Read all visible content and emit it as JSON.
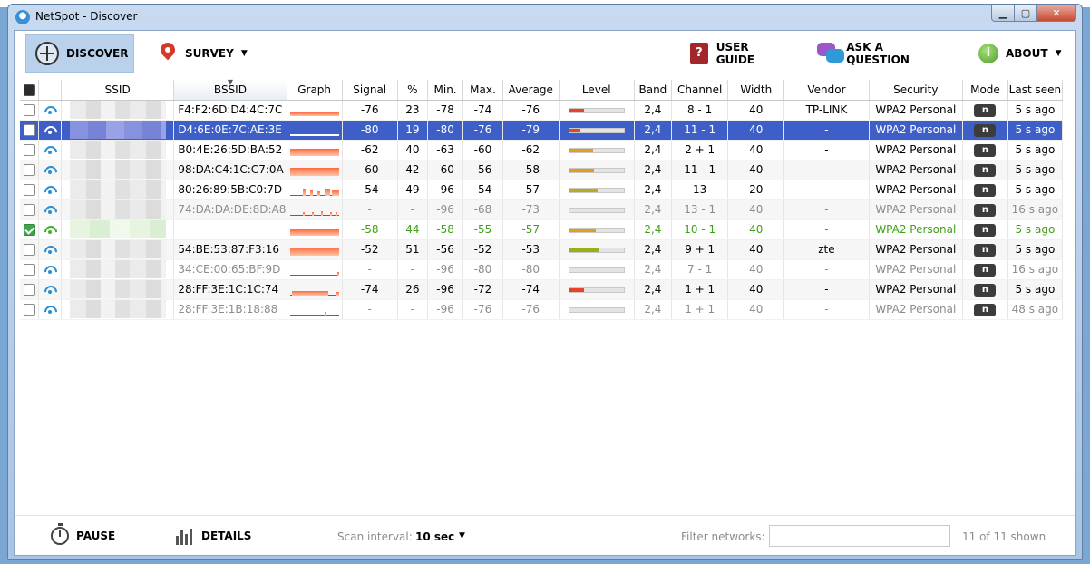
{
  "window": {
    "title": "NetSpot - Discover"
  },
  "toolbar": {
    "discover": "DISCOVER",
    "survey": "SURVEY",
    "user_guide": "USER GUIDE",
    "ask": "ASK A QUESTION",
    "about": "ABOUT",
    "guide_icon_glyph": "?",
    "about_icon_glyph": "i"
  },
  "columns": [
    "SSID",
    "BSSID",
    "Graph",
    "Signal",
    "%",
    "Min.",
    "Max.",
    "Average",
    "Level",
    "Band",
    "Channel",
    "Width",
    "Vendor",
    "Security",
    "Mode",
    "Last seen"
  ],
  "rows": [
    {
      "bssid": "F4:F2:6D:D4:4C:7C",
      "signal": "-76",
      "pct": "23",
      "min": "-78",
      "max": "-74",
      "avg": "-76",
      "level": 0.26,
      "level_color": "#e8432a",
      "band": "2,4",
      "channel": "8 - 1",
      "width": "40",
      "vendor": "TP-LINK",
      "security": "WPA2 Personal",
      "mode": "n",
      "last_seen": "5 s ago",
      "state": "",
      "checked": false,
      "graph": [
        [
          0,
          54,
          4
        ]
      ]
    },
    {
      "bssid": "D4:6E:0E:7C:AE:3E",
      "signal": "-80",
      "pct": "19",
      "min": "-80",
      "max": "-76",
      "avg": "-79",
      "level": 0.2,
      "level_color": "#e8432a",
      "band": "2,4",
      "channel": "11 - 1",
      "width": "40",
      "vendor": "-",
      "security": "WPA2 Personal",
      "mode": "n",
      "last_seen": "5 s ago",
      "state": "sel",
      "checked": false,
      "graph": [
        [
          0,
          54,
          2
        ]
      ]
    },
    {
      "bssid": "B0:4E:26:5D:BA:52",
      "signal": "-62",
      "pct": "40",
      "min": "-63",
      "max": "-60",
      "avg": "-62",
      "level": 0.42,
      "level_color": "#e89a1a",
      "band": "2,4",
      "channel": "2 + 1",
      "width": "40",
      "vendor": "-",
      "security": "WPA2 Personal",
      "mode": "n",
      "last_seen": "5 s ago",
      "state": "",
      "checked": false,
      "graph": [
        [
          0,
          54,
          8
        ]
      ]
    },
    {
      "bssid": "98:DA:C4:1C:C7:0A",
      "signal": "-60",
      "pct": "42",
      "min": "-60",
      "max": "-56",
      "avg": "-58",
      "level": 0.44,
      "level_color": "#e89a1a",
      "band": "2,4",
      "channel": "11 - 1",
      "width": "40",
      "vendor": "-",
      "security": "WPA2 Personal",
      "mode": "n",
      "last_seen": "5 s ago",
      "state": "",
      "checked": false,
      "graph": [
        [
          0,
          54,
          9
        ]
      ]
    },
    {
      "bssid": "80:26:89:5B:C0:7D",
      "signal": "-54",
      "pct": "49",
      "min": "-96",
      "max": "-54",
      "avg": "-57",
      "level": 0.5,
      "level_color": "#b6ad1c",
      "band": "2,4",
      "channel": "13",
      "width": "20",
      "vendor": "-",
      "security": "WPA2 Personal",
      "mode": "n",
      "last_seen": "5 s ago",
      "state": "",
      "checked": false,
      "graph": [
        [
          14,
          3,
          8
        ],
        [
          22,
          3,
          6
        ],
        [
          30,
          3,
          5
        ],
        [
          38,
          6,
          8
        ],
        [
          46,
          8,
          6
        ]
      ]
    },
    {
      "bssid": "74:DA:DA:DE:8D:A8",
      "signal": "-",
      "pct": "-",
      "min": "-96",
      "max": "-68",
      "avg": "-73",
      "level": 0,
      "level_color": "#e89a1a",
      "band": "2,4",
      "channel": "13 - 1",
      "width": "40",
      "vendor": "-",
      "security": "WPA2 Personal",
      "mode": "n",
      "last_seen": "16 s ago",
      "state": "dim",
      "checked": false,
      "graph": [
        [
          14,
          2,
          4
        ],
        [
          24,
          2,
          4
        ],
        [
          34,
          2,
          5
        ],
        [
          44,
          2,
          4
        ],
        [
          50,
          2,
          4
        ]
      ]
    },
    {
      "bssid": "",
      "signal": "-58",
      "pct": "44",
      "min": "-58",
      "max": "-55",
      "avg": "-57",
      "level": 0.46,
      "level_color": "#e89a1a",
      "band": "2,4",
      "channel": "10 - 1",
      "width": "40",
      "vendor": "-",
      "security": "WPA2 Personal",
      "mode": "n",
      "last_seen": "5 s ago",
      "state": "green",
      "checked": true,
      "graph": [
        [
          0,
          54,
          7
        ]
      ]
    },
    {
      "bssid": "54:BE:53:87:F3:16",
      "signal": "-52",
      "pct": "51",
      "min": "-56",
      "max": "-52",
      "avg": "-53",
      "level": 0.54,
      "level_color": "#9cad1c",
      "band": "2,4",
      "channel": "9 + 1",
      "width": "40",
      "vendor": "zte",
      "security": "WPA2 Personal",
      "mode": "n",
      "last_seen": "5 s ago",
      "state": "",
      "checked": false,
      "graph": [
        [
          0,
          54,
          9
        ]
      ]
    },
    {
      "bssid": "34:CE:00:65:BF:9D",
      "signal": "-",
      "pct": "-",
      "min": "-96",
      "max": "-80",
      "avg": "-80",
      "level": 0,
      "level_color": "#e8432a",
      "band": "2,4",
      "channel": "7 - 1",
      "width": "40",
      "vendor": "-",
      "security": "WPA2 Personal",
      "mode": "n",
      "last_seen": "16 s ago",
      "state": "dim",
      "checked": false,
      "graph": [
        [
          52,
          2,
          4
        ]
      ]
    },
    {
      "bssid": "28:FF:3E:1C:1C:74",
      "signal": "-74",
      "pct": "26",
      "min": "-96",
      "max": "-72",
      "avg": "-74",
      "level": 0.26,
      "level_color": "#e8432a",
      "band": "2,4",
      "channel": "1 + 1",
      "width": "40",
      "vendor": "-",
      "security": "WPA2 Personal",
      "mode": "n",
      "last_seen": "5 s ago",
      "state": "",
      "checked": false,
      "graph": [
        [
          2,
          40,
          5
        ],
        [
          50,
          4,
          4
        ]
      ]
    },
    {
      "bssid": "28:FF:3E:1B:18:88",
      "signal": "-",
      "pct": "-",
      "min": "-96",
      "max": "-76",
      "avg": "-76",
      "level": 0,
      "level_color": "#e8432a",
      "band": "2,4",
      "channel": "1 + 1",
      "width": "40",
      "vendor": "-",
      "security": "WPA2 Personal",
      "mode": "n",
      "last_seen": "48 s ago",
      "state": "dim",
      "checked": false,
      "graph": [
        [
          38,
          2,
          4
        ]
      ]
    }
  ],
  "bottom": {
    "pause": "PAUSE",
    "details": "DETAILS",
    "scan_label": "Scan interval:",
    "scan_value": "10 sec",
    "filter_label": "Filter networks:",
    "filter_value": "",
    "shown": "11 of 11 shown"
  }
}
